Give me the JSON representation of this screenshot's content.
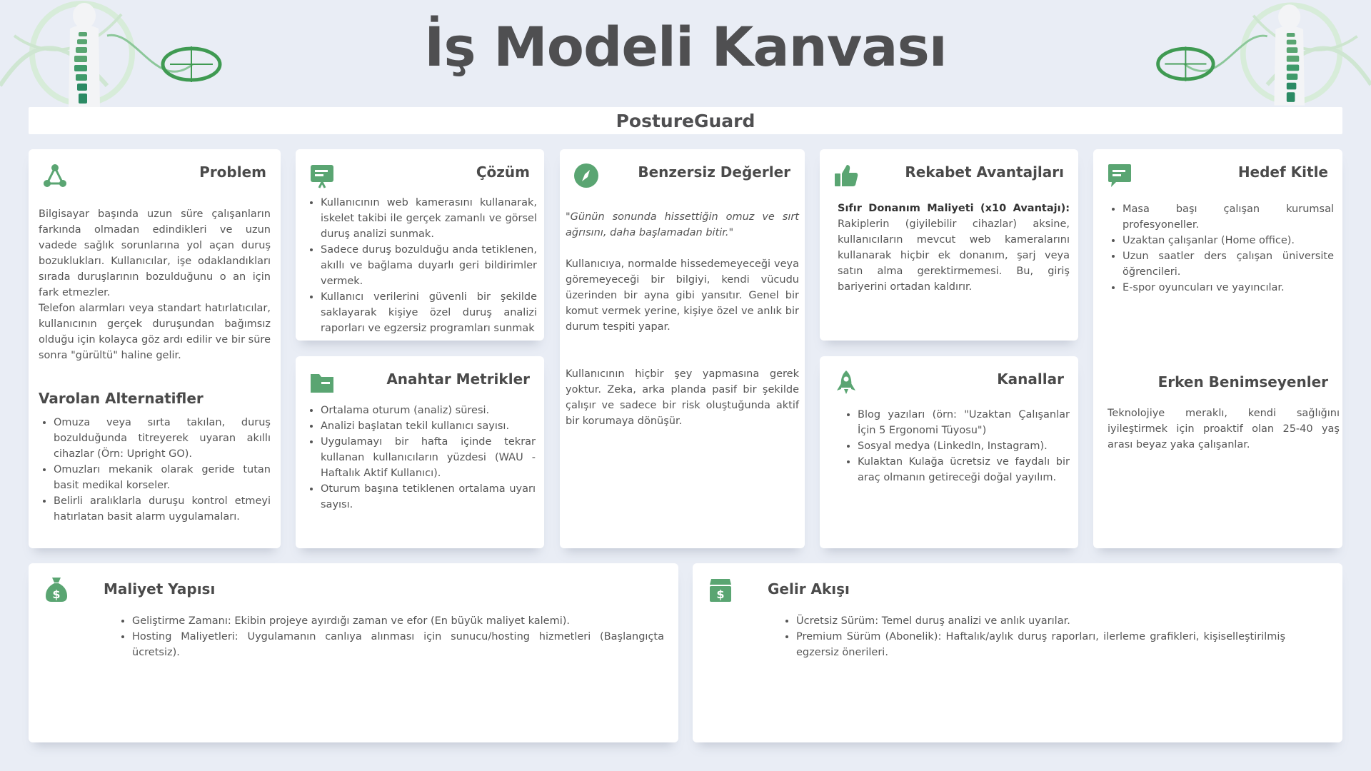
{
  "title": "İş Modeli Kanvası",
  "subtitle": "PostureGuard",
  "colors": {
    "accent": "#5aa572",
    "background": "#e9edf5",
    "card": "#ffffff"
  },
  "problem": {
    "title": "Problem",
    "icon": "network-nodes-icon",
    "p1": "Bilgisayar başında uzun süre çalışanların farkında olmadan edindikleri ve uzun vadede sağlık sorunlarına yol açan duruş bozuklukları. Kullanıcılar, işe odaklandıkları sırada duruşlarının bozulduğunu o an için fark etmezler.",
    "p2": "Telefon alarmları veya standart hatırlatıcılar, kullanıcının gerçek duruşundan bağımsız olduğu için kolayca göz ardı edilir ve bir süre sonra \"gürültü\" haline gelir.",
    "alt_title": "Varolan Alternatifler",
    "alternatives": [
      "Omuza veya sırta takılan, duruş bozulduğunda titreyerek uyaran akıllı cihazlar (Örn: Upright GO).",
      "Omuzları mekanik olarak geride tutan basit medikal korseler.",
      "Belirli aralıklarla duruşu kontrol etmeyi hatırlatan basit alarm uygulamaları."
    ]
  },
  "solution": {
    "title": "Çözüm",
    "icon": "presentation-board-icon",
    "items": [
      "Kullanıcının web kamerasını kullanarak, iskelet takibi ile gerçek zamanlı ve görsel duruş analizi sunmak.",
      "Sadece duruş bozulduğu anda tetiklenen, akıllı ve bağlama duyarlı geri bildirimler vermek.",
      "Kullanıcı verilerini güvenli bir şekilde saklayarak kişiye özel duruş analizi raporları ve egzersiz programları sunmak"
    ]
  },
  "metrics": {
    "title": "Anahtar Metrikler",
    "icon": "folder-icon",
    "items": [
      "Ortalama oturum (analiz) süresi.",
      "Analizi başlatan tekil kullanıcı sayısı.",
      "Uygulamayı bir hafta içinde tekrar kullanan kullanıcıların yüzdesi (WAU - Haftalık Aktif Kullanıcı).",
      "Oturum başına tetiklenen ortalama uyarı sayısı."
    ]
  },
  "value": {
    "title": "Benzersiz Değerler",
    "icon": "compass-icon",
    "quote": "\"Günün sonunda hissettiğin omuz ve sırt ağrısını, daha başlamadan bitir.\"",
    "p1": "Kullanıcıya, normalde hissedemeyeceği veya göremeyeceği bir bilgiyi, kendi vücudu üzerinden bir ayna gibi yansıtır. Genel bir komut vermek yerine, kişiye özel ve anlık bir durum tespiti yapar.",
    "p2": "Kullanıcının hiçbir şey yapmasına gerek yoktur. Zeka, arka planda pasif bir şekilde çalışır ve sadece bir risk oluştuğunda aktif bir korumaya dönüşür."
  },
  "advantage": {
    "title": "Rekabet Avantajları",
    "icon": "thumbs-up-icon",
    "lead": "Sıfır Donanım Maliyeti (x10 Avantajı):",
    "text": " Rakiplerin (giyilebilir cihazlar) aksine, kullanıcıların mevcut web kameralarını kullanarak hiçbir ek donanım, şarj veya satın alma gerektirmemesi. Bu, giriş bariyerini ortadan kaldırır."
  },
  "channels": {
    "title": "Kanallar",
    "icon": "rocket-icon",
    "items": [
      "Blog yazıları (örn: \"Uzaktan Çalışanlar İçin 5 Ergonomi Tüyosu\")",
      "Sosyal medya (LinkedIn, Instagram).",
      "Kulaktan Kulağa ücretsiz ve faydalı bir araç olmanın getireceği doğal yayılım."
    ]
  },
  "audience": {
    "title": "Hedef Kitle",
    "icon": "chat-bubble-icon",
    "items": [
      "Masa başı çalışan kurumsal profesyoneller.",
      "Uzaktan çalışanlar (Home office).",
      "Uzun saatler ders çalışan üniversite öğrencileri.",
      "E-spor oyuncuları ve yayıncılar."
    ],
    "early_title": "Erken Benimseyenler",
    "early_text": "Teknolojiye meraklı, kendi sağlığını iyileştirmek için proaktif olan 25-40 yaş arası beyaz yaka çalışanlar."
  },
  "cost": {
    "title": "Maliyet Yapısı",
    "icon": "money-bag-icon",
    "items": [
      "Geliştirme Zamanı: Ekibin projeye ayırdığı zaman ve efor (En büyük maliyet kalemi).",
      "Hosting Maliyetleri: Uygulamanın canlıya alınması için sunucu/hosting hizmetleri (Başlangıçta ücretsiz)."
    ]
  },
  "revenue": {
    "title": "Gelir Akışı",
    "icon": "cash-register-icon",
    "items": [
      "Ücretsiz Sürüm: Temel duruş analizi ve anlık uyarılar.",
      "Premium Sürüm (Abonelik): Haftalık/aylık duruş raporları, ilerleme grafikleri, kişiselleştirilmiş egzersiz önerileri."
    ]
  }
}
